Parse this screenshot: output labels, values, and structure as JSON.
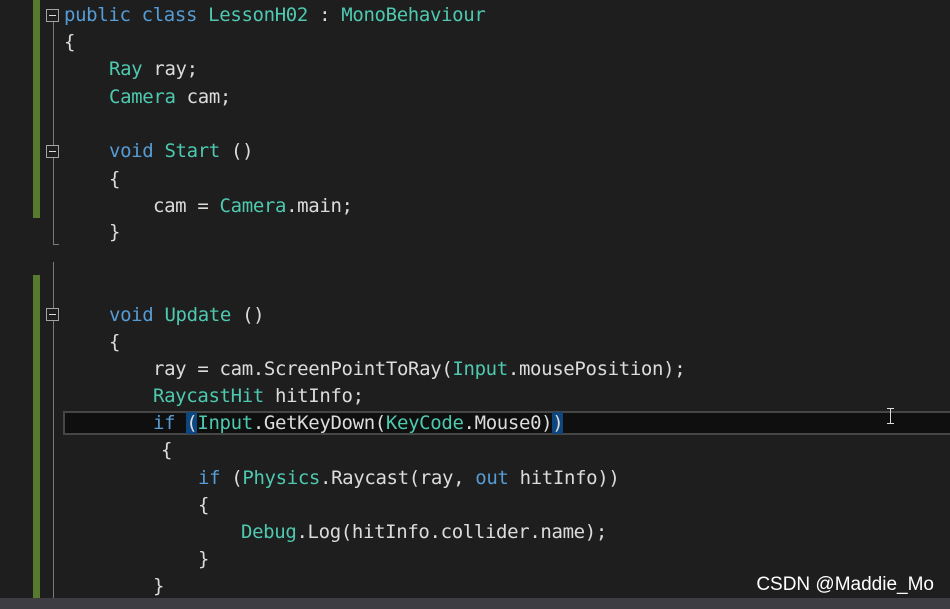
{
  "editor": {
    "lines": [
      [
        {
          "t": "public class ",
          "c": "kw"
        },
        {
          "t": "LessonH02",
          "c": "ty"
        },
        {
          "t": " : ",
          "c": "pl"
        },
        {
          "t": "MonoBehaviour",
          "c": "ty"
        }
      ],
      [
        {
          "t": "{",
          "c": "pl"
        }
      ],
      [
        {
          "t": "Ray",
          "c": "ty"
        },
        {
          "t": " ray;",
          "c": "pl"
        }
      ],
      [
        {
          "t": "Camera",
          "c": "ty"
        },
        {
          "t": " cam;",
          "c": "pl"
        }
      ],
      [],
      [
        {
          "t": "void",
          "c": "kw"
        },
        {
          "t": " ",
          "c": "pl"
        },
        {
          "t": "Start",
          "c": "ty"
        },
        {
          "t": " ()",
          "c": "pl"
        }
      ],
      [
        {
          "t": "{",
          "c": "pl"
        }
      ],
      [
        {
          "t": "cam = ",
          "c": "pl"
        },
        {
          "t": "Camera",
          "c": "ty"
        },
        {
          "t": ".main;",
          "c": "pl"
        }
      ],
      [
        {
          "t": "}",
          "c": "pl"
        }
      ],
      [],
      [],
      [
        {
          "t": "void",
          "c": "kw"
        },
        {
          "t": " ",
          "c": "pl"
        },
        {
          "t": "Update",
          "c": "ty"
        },
        {
          "t": " ()",
          "c": "pl"
        }
      ],
      [
        {
          "t": "{",
          "c": "pl"
        }
      ],
      [
        {
          "t": "ray = cam.ScreenPointToRay(",
          "c": "pl"
        },
        {
          "t": "Input",
          "c": "ty"
        },
        {
          "t": ".mousePosition);",
          "c": "pl"
        }
      ],
      [
        {
          "t": "RaycastHit",
          "c": "ty"
        },
        {
          "t": " hitInfo;",
          "c": "pl"
        }
      ],
      [
        {
          "t": "if",
          "c": "kw"
        },
        {
          "t": " ",
          "c": "pl"
        },
        {
          "t": "(",
          "c": "pl brace-hl"
        },
        {
          "t": "Input",
          "c": "ty"
        },
        {
          "t": ".GetKeyDown(",
          "c": "pl"
        },
        {
          "t": "KeyCode",
          "c": "ty"
        },
        {
          "t": ".Mouse0)",
          "c": "pl"
        },
        {
          "t": ")",
          "c": "pl brace-hl"
        }
      ],
      [
        {
          "t": "{",
          "c": "pl"
        }
      ],
      [
        {
          "t": "if",
          "c": "kw"
        },
        {
          "t": " (",
          "c": "pl"
        },
        {
          "t": "Physics",
          "c": "ty"
        },
        {
          "t": ".Raycast(ray, ",
          "c": "pl"
        },
        {
          "t": "out",
          "c": "kw"
        },
        {
          "t": " hitInfo))",
          "c": "pl"
        }
      ],
      [
        {
          "t": "{",
          "c": "pl"
        }
      ],
      [
        {
          "t": "Debug",
          "c": "ty"
        },
        {
          "t": ".Log(hitInfo.collider.name);",
          "c": "pl"
        }
      ],
      [
        {
          "t": "}",
          "c": "pl"
        }
      ],
      [
        {
          "t": "}",
          "c": "pl"
        }
      ]
    ]
  },
  "watermark": "CSDN @Maddie_Mo",
  "colors": {
    "background": "#1e1e1e",
    "keyword": "#569cd6",
    "type": "#4ec9b0",
    "plain": "#dcdcdc",
    "change_bar": "#577a2e",
    "brace_highlight": "#0e4680"
  },
  "icons": [
    "fold-collapse-icon",
    "text-cursor-ibeam-icon"
  ]
}
